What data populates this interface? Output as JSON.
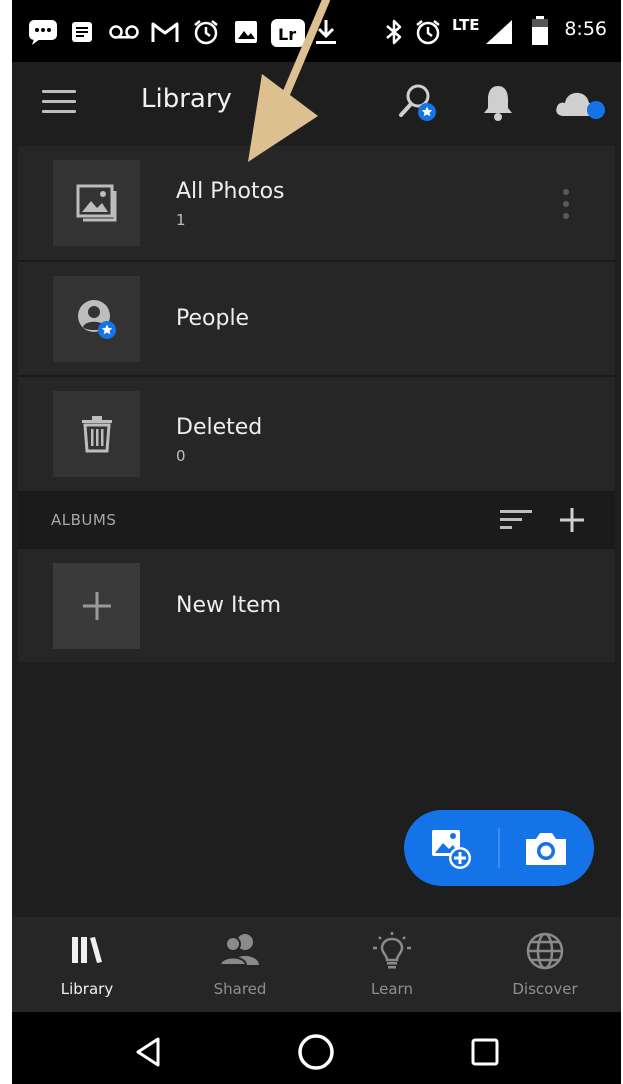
{
  "status_bar": {
    "time": "8:56",
    "network": "LTE",
    "notification_icons": [
      "messages-icon",
      "notes-icon",
      "voicemail-icon",
      "gmail-icon",
      "alarm-icon",
      "image-icon",
      "lightroom-icon",
      "download-icon"
    ],
    "system_icons": [
      "bluetooth-icon",
      "alarm-icon",
      "signal-icon",
      "battery-icon"
    ]
  },
  "app_bar": {
    "title": "Library"
  },
  "library": {
    "items": [
      {
        "name": "All Photos",
        "count": "1",
        "icon": "photos-icon"
      },
      {
        "name": "People",
        "count": "",
        "icon": "people-icon"
      },
      {
        "name": "Deleted",
        "count": "0",
        "icon": "trash-icon"
      }
    ]
  },
  "albums": {
    "section_label": "ALBUMS",
    "items": [
      {
        "name": "New Item",
        "icon": "plus-icon"
      }
    ]
  },
  "bottom_nav": {
    "items": [
      {
        "label": "Library",
        "icon": "library-icon",
        "active": true
      },
      {
        "label": "Shared",
        "icon": "shared-icon",
        "active": false
      },
      {
        "label": "Learn",
        "icon": "lightbulb-icon",
        "active": false
      },
      {
        "label": "Discover",
        "icon": "globe-icon",
        "active": false
      }
    ]
  },
  "colors": {
    "accent": "#1473e6",
    "background": "#1e1e1e",
    "row": "#262626",
    "tile": "#333333",
    "annotation_arrow": "#dcc090"
  }
}
